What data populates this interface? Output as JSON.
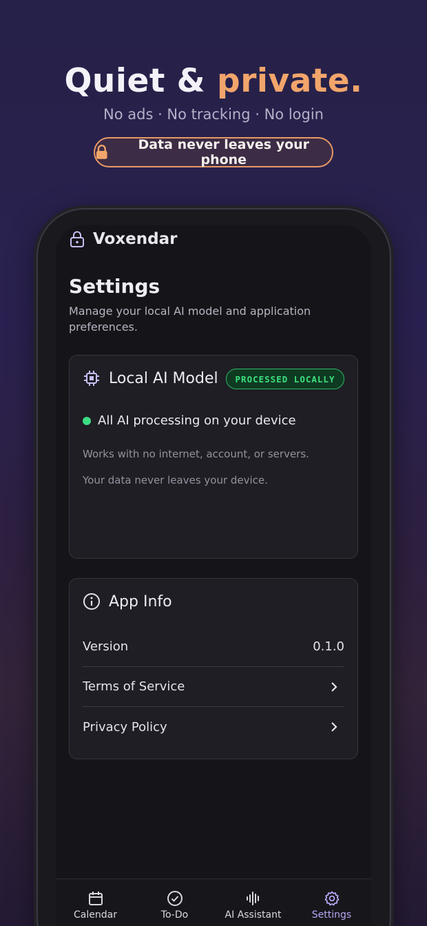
{
  "hero": {
    "title_main": "Quiet & ",
    "title_accent": "private.",
    "subtitle": "No ads · No tracking · No login",
    "pill": "Data never leaves your phone"
  },
  "app": {
    "name": "Voxendar"
  },
  "settings": {
    "title": "Settings",
    "description": "Manage your local AI model and application preferences."
  },
  "local_ai": {
    "title": "Local AI Model",
    "badge": "PROCESSED LOCALLY",
    "status": "All AI processing on your device",
    "note1": "Works with no internet, account, or servers.",
    "note2": "Your data never leaves your device."
  },
  "app_info": {
    "title": "App Info",
    "rows": [
      {
        "label": "Version",
        "value": "0.1.0"
      },
      {
        "label": "Terms of Service"
      },
      {
        "label": "Privacy Policy"
      }
    ]
  },
  "tabs": [
    {
      "label": "Calendar",
      "icon": "calendar-icon"
    },
    {
      "label": "To-Do",
      "icon": "check-circle-icon"
    },
    {
      "label": "AI Assistant",
      "icon": "waveform-icon"
    },
    {
      "label": "Settings",
      "icon": "gear-icon",
      "active": true
    }
  ],
  "colors": {
    "accent_orange": "#f2a56b",
    "badge_green": "#3ee07f",
    "active_tab": "#b9a6f5"
  }
}
